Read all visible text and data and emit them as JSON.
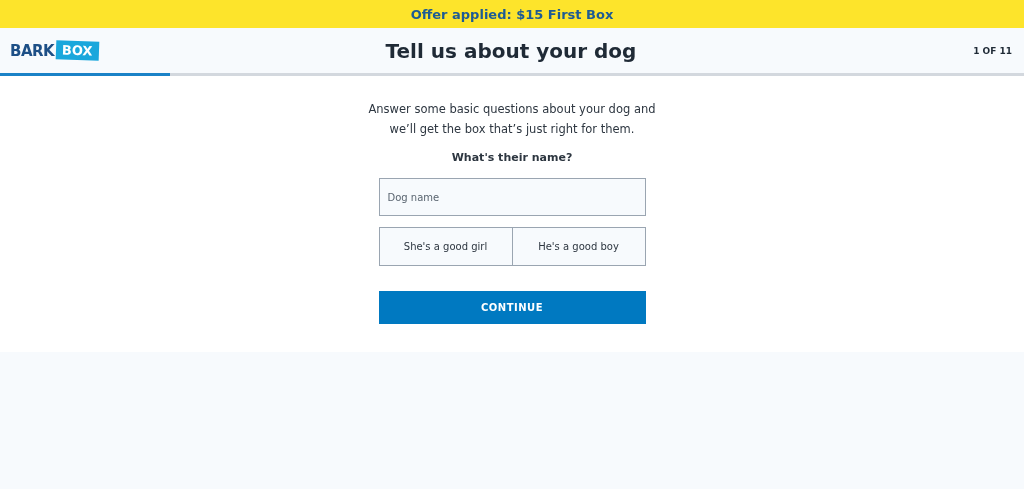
{
  "banner": {
    "text": "Offer applied: $15 First Box"
  },
  "header": {
    "logo": {
      "word": "BARK",
      "badge": "BOX"
    },
    "title": "Tell us about your dog",
    "step": "1 OF 11"
  },
  "progress": {
    "level": 0.166
  },
  "intro": "Answer some basic questions about your dog and we’ll get the box that’s just right for them.",
  "question": "What's their name?",
  "name_field": {
    "placeholder": "Dog name"
  },
  "gender_options": [
    {
      "label": "She's a good girl",
      "selected": false
    },
    {
      "label": "He's a good boy",
      "selected": false
    }
  ],
  "continue_button": "CONTINUE"
}
